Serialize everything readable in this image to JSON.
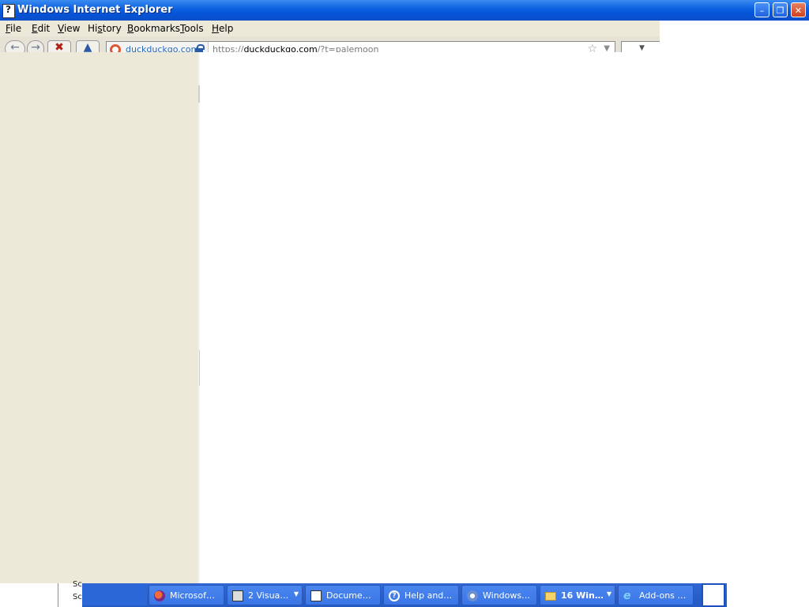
{
  "window": {
    "title": "Windows Internet Explorer"
  },
  "menu": [
    "File",
    "Edit",
    "View",
    "History",
    "Bookmarks",
    "Tools",
    "Help"
  ],
  "menu_accel": [
    "F",
    "E",
    "V",
    "s",
    "B",
    "T",
    "H"
  ],
  "address_bar": {
    "identity": "duckduckgo.com",
    "url_prefix": "https://",
    "url_host": "duckduckgo.com",
    "url_rest": "/?t=palemoon"
  },
  "behind_window": {
    "lines": [
      "Sc",
      "Sc"
    ]
  },
  "taskbar": {
    "buttons": [
      {
        "label": "Microsof…",
        "icon": "app-icon"
      },
      {
        "label": "2 Visua…",
        "icon": "studio-icon",
        "group": true
      },
      {
        "label": "Docume…",
        "icon": "document-icon"
      },
      {
        "label": "Help and…",
        "icon": "help-icon"
      },
      {
        "label": "Windows…",
        "icon": "media-icon"
      },
      {
        "label": "16 Win…",
        "icon": "folder-icon",
        "group": true
      },
      {
        "label": "Add-ons …",
        "icon": "ie-icon"
      }
    ]
  },
  "colors": {
    "titlebar": "#0a5fe0",
    "panel": "#ece9d8",
    "taskbar": "#245bc2",
    "close": "#d04020"
  }
}
